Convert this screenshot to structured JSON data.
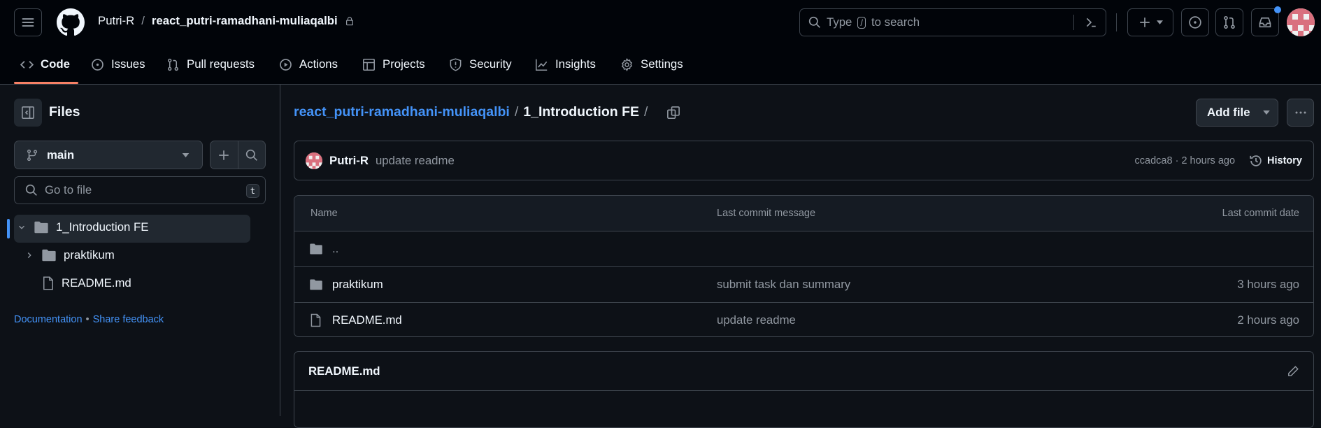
{
  "header": {
    "owner": "Putri-R",
    "separator": "/",
    "repo": "react_putri-ramadhani-muliaqalbi",
    "search_prefix": "Type",
    "search_key": "/",
    "search_suffix": "to search",
    "notification_dot_color": "#4493f8"
  },
  "tabs": [
    {
      "label": "Code",
      "icon": "code-icon"
    },
    {
      "label": "Issues",
      "icon": "issue-icon"
    },
    {
      "label": "Pull requests",
      "icon": "pull-request-icon"
    },
    {
      "label": "Actions",
      "icon": "play-icon"
    },
    {
      "label": "Projects",
      "icon": "table-icon"
    },
    {
      "label": "Security",
      "icon": "shield-icon"
    },
    {
      "label": "Insights",
      "icon": "graph-icon"
    },
    {
      "label": "Settings",
      "icon": "gear-icon"
    }
  ],
  "sidebar": {
    "title": "Files",
    "branch": "main",
    "goto_placeholder": "Go to file",
    "goto_shortcut": "t",
    "tree": [
      {
        "label": "1_Introduction FE",
        "type": "folder",
        "expanded": true,
        "selected": true
      },
      {
        "label": "praktikum",
        "type": "folder",
        "expanded": false
      },
      {
        "label": "README.md",
        "type": "file"
      }
    ],
    "footer_doc": "Documentation",
    "footer_sep": "•",
    "footer_feedback": "Share feedback"
  },
  "main": {
    "breadcrumb_repo": "react_putri-ramadhani-muliaqalbi",
    "breadcrumb_sep": "/",
    "breadcrumb_current": "1_Introduction FE",
    "breadcrumb_trailing": "/",
    "add_file": "Add file",
    "commit": {
      "author": "Putri-R",
      "message": "update readme",
      "meta": "ccadca8 · 2 hours ago",
      "history": "History"
    },
    "table": {
      "headers": [
        "Name",
        "Last commit message",
        "Last commit date"
      ],
      "rows": [
        {
          "name": "..",
          "type": "folder",
          "message": "",
          "date": ""
        },
        {
          "name": "praktikum",
          "type": "folder",
          "message": "submit task dan summary",
          "date": "3 hours ago"
        },
        {
          "name": "README.md",
          "type": "file",
          "message": "update readme",
          "date": "2 hours ago"
        }
      ]
    },
    "readme_title": "README.md"
  }
}
